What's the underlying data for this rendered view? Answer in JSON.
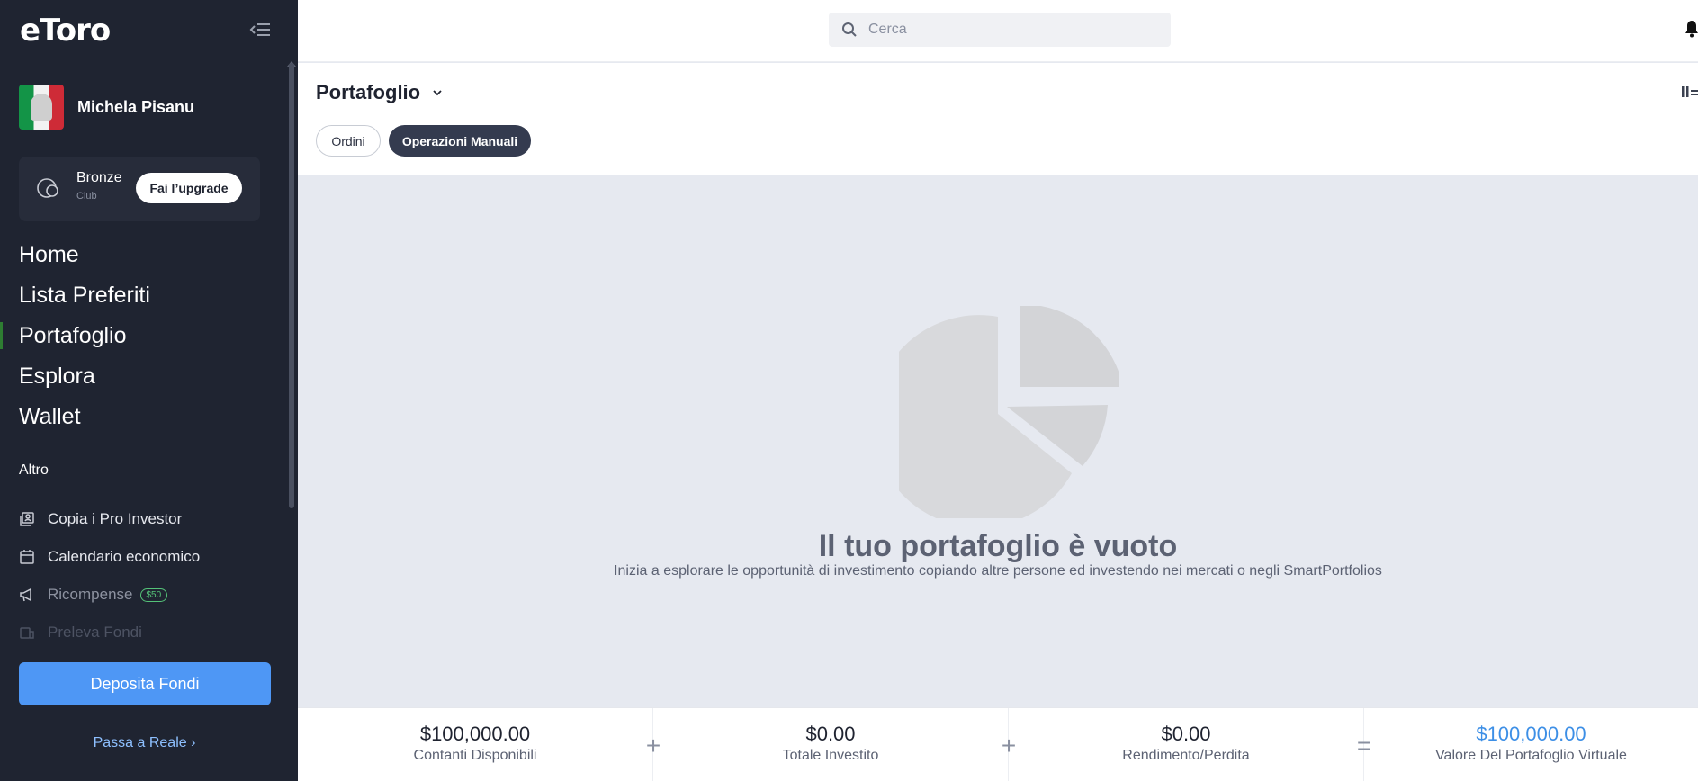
{
  "sidebar": {
    "logo": "eToro",
    "user_name": "Michela Pisanu",
    "club": {
      "title": "Bronze",
      "subtitle": "Club",
      "upgrade_label": "Fai l’upgrade"
    },
    "nav": [
      "Home",
      "Lista Preferiti",
      "Portafoglio",
      "Esplora",
      "Wallet"
    ],
    "section_label": "Altro",
    "sub_nav": [
      {
        "label": "Copia i Pro Investor",
        "icon": "copy-people-icon"
      },
      {
        "label": "Calendario economico",
        "icon": "calendar-icon"
      },
      {
        "label": "Ricompense",
        "icon": "megaphone-icon",
        "badge": "$50"
      },
      {
        "label": "Preleva Fondi",
        "icon": "withdraw-icon"
      }
    ],
    "deposit_label": "Deposita Fondi",
    "real_link_label": "Passa a Reale"
  },
  "topbar": {
    "search_placeholder": "Cerca"
  },
  "header": {
    "title": "Portafoglio",
    "tabs": [
      "Ordini",
      "Operazioni Manuali"
    ],
    "active_tab": "Operazioni Manuali"
  },
  "empty_state": {
    "title": "Il tuo portafoglio è vuoto",
    "subtitle": "Inizia a esplorare le opportunità di investimento copiando altre persone ed investendo nei mercati o negli SmartPortfolios"
  },
  "footer": {
    "stats": [
      {
        "value": "$100,000.00",
        "label": "Contanti Disponibili"
      },
      {
        "value": "$0.00",
        "label": "Totale Investito"
      },
      {
        "value": "$0.00",
        "label": "Rendimento/Perdita"
      },
      {
        "value": "$100,000.00",
        "label": "Valore Del Portafoglio Virtuale"
      }
    ],
    "operators": [
      "+",
      "+",
      "="
    ]
  },
  "colors": {
    "sidebar_bg": "#1f2431",
    "accent_blue": "#4e97f5",
    "active_tab_bg": "#343b4f",
    "highlight_value": "#3d8fe6"
  }
}
